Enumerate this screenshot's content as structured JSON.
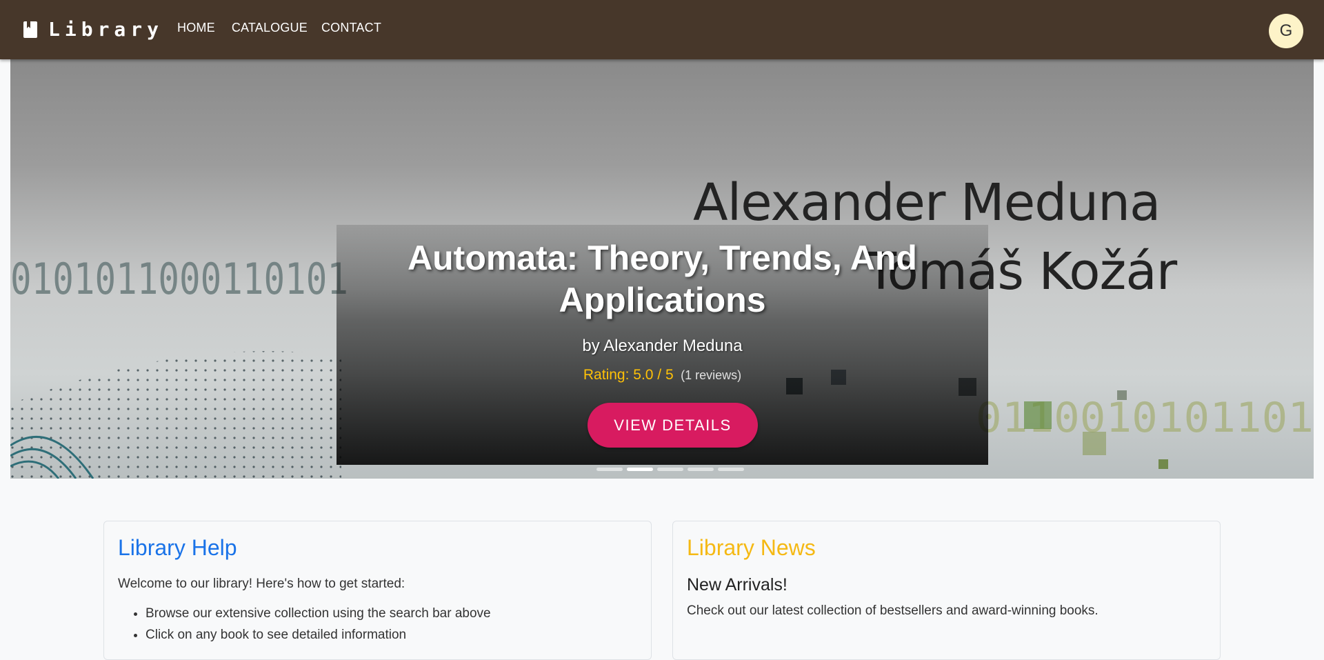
{
  "navbar": {
    "brand": "Library",
    "links": [
      "HOME",
      "CATALOGUE",
      "CONTACT"
    ],
    "avatar_initial": "G",
    "bg_color": "#47372a"
  },
  "hero": {
    "cover_author_line_1": "Alexander Meduna",
    "cover_author_line_2": "Tomáš Kožár",
    "title": "Automata: Theory, Trends, And Applications",
    "author": "by Alexander Meduna",
    "rating": "Rating: 5.0 / 5",
    "reviews": "(1 reviews)",
    "button_label": "VIEW DETAILS",
    "slide_count": 5,
    "active_slide": 2,
    "accent_color": "#d81b60",
    "rating_color": "#ffc107"
  },
  "help_card": {
    "title": "Library Help",
    "intro": "Welcome to our library! Here's how to get started:",
    "items": [
      "Browse our extensive collection using the search bar above",
      "Click on any book to see detailed information"
    ],
    "title_color": "#1a73e8"
  },
  "news_card": {
    "title": "Library News",
    "heading": "New Arrivals!",
    "text": "Check out our latest collection of bestsellers and award-winning books.",
    "title_color": "#f5b914"
  }
}
